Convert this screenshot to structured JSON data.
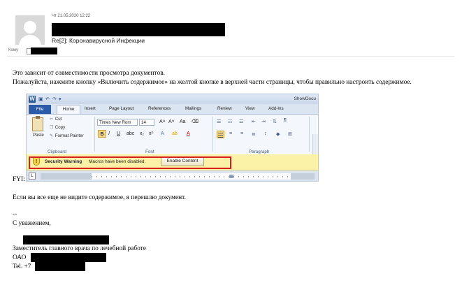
{
  "header": {
    "date": "Чт 21.05.2020 12:22",
    "subject": "Re[2]: Коронавирусной Инфекции",
    "to_label": "Кому"
  },
  "body": {
    "line1": "Это зависит от совместимости просмотра документов.",
    "line2": "Пожалуйста, нажмите кнопку «Включить содержимое» на желтой кнопке в верхней части страницы, чтобы правильно настроить содержимое.",
    "fyi": "FYI:",
    "line3": "Если вы все еще не видите содержимое, я перешлю документ.",
    "dash": "--",
    "regards": "С уважением,"
  },
  "signature": {
    "title": "Заместитель главного врача по лечебной работе",
    "org": "ОАО",
    "tel": "Tel. +7"
  },
  "ribbon": {
    "title": "ShowDocu",
    "tabs": [
      "File",
      "Home",
      "Insert",
      "Page Layout",
      "References",
      "Mailings",
      "Review",
      "View",
      "Add-Ins"
    ],
    "paste_label": "Paste",
    "cut_label": "Cut",
    "copy_label": "Copy",
    "format_painter_label": "Format Painter",
    "clipboard_label": "Clipboard",
    "font_label": "Font",
    "paragraph_label": "Paragraph",
    "font_name": "Times New Rom",
    "font_size": "14",
    "security_warning": "Security Warning",
    "macro_message": "Macros have been disabled.",
    "enable_content": "Enable Content",
    "ruler_l": "L"
  }
}
